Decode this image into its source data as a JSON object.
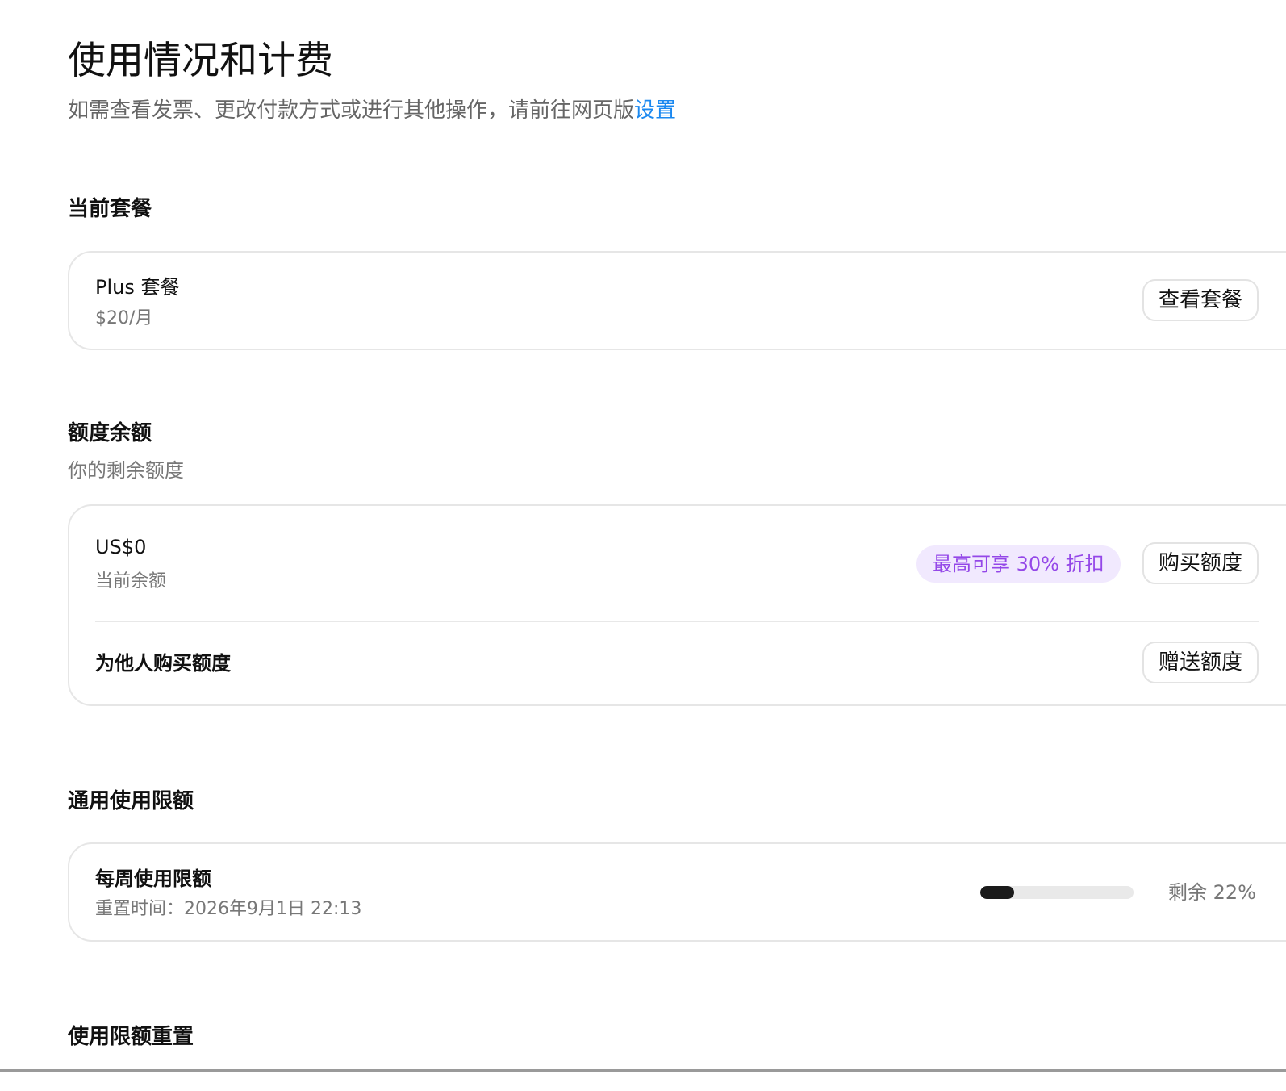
{
  "header": {
    "title": "使用情况和计费",
    "subtitle_prefix": "如需查看发票、更改付款方式或进行其他操作，请前往网页版",
    "settings_link": "设置"
  },
  "current_plan": {
    "section_title": "当前套餐",
    "plan_name": "Plus 套餐",
    "plan_price": "$20/月",
    "view_plans_label": "查看套餐"
  },
  "credit_balance": {
    "section_title": "额度余额",
    "section_subtitle": "你的剩余额度",
    "amount": "US$0",
    "amount_label": "当前余额",
    "discount_badge": "最高可享 30% 折扣",
    "buy_label": "购买额度",
    "gift_row_label": "为他人购买额度",
    "gift_label": "赠送额度"
  },
  "usage_limits": {
    "section_title": "通用使用限额",
    "weekly_title": "每周使用限额",
    "reset_time": "重置时间：2026年9月1日 22:13",
    "remaining_text": "剩余 22%",
    "remaining_fraction": 0.22
  },
  "limit_reset": {
    "section_title": "使用限额重置"
  },
  "colors": {
    "link": "#1a88f0",
    "badge_text": "#9447e8",
    "badge_bg": "#f1e9fe",
    "progress_fill": "#1b1b1b",
    "progress_track": "#e9e9e9"
  }
}
